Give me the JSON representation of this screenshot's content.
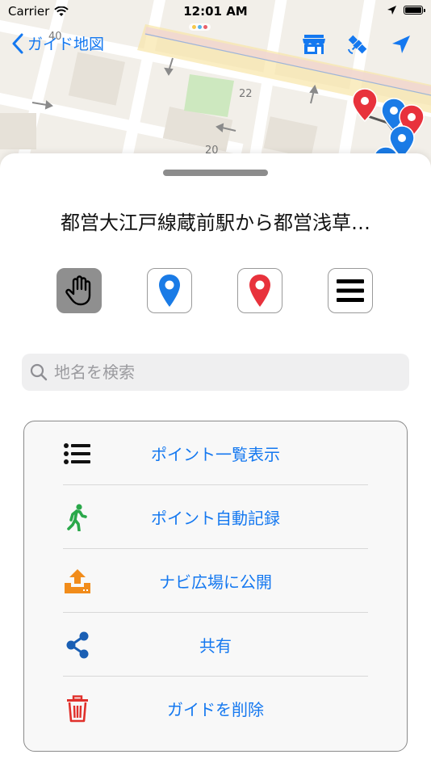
{
  "status_bar": {
    "carrier": "Carrier",
    "time": "12:01 AM"
  },
  "nav": {
    "back_label": "ガイド地図",
    "icons": [
      "store-icon",
      "satellite-icon",
      "location-arrow-icon"
    ]
  },
  "map": {
    "labels": [
      "40",
      "22",
      "20"
    ]
  },
  "sheet": {
    "title": "都営大江戸線蔵前駅から都営浅草…",
    "modes": [
      {
        "name": "hand-mode",
        "active": true
      },
      {
        "name": "blue-pin-mode",
        "active": false
      },
      {
        "name": "red-pin-mode",
        "active": false
      },
      {
        "name": "menu-mode",
        "active": false
      }
    ],
    "search_placeholder": "地名を検索",
    "menu_items": [
      {
        "label": "ポイント一覧表示",
        "icon": "list-icon"
      },
      {
        "label": "ポイント自動記録",
        "icon": "walking-icon"
      },
      {
        "label": "ナビ広場に公開",
        "icon": "upload-icon"
      },
      {
        "label": "共有",
        "icon": "share-icon"
      },
      {
        "label": "ガイドを削除",
        "icon": "trash-icon"
      }
    ]
  },
  "colors": {
    "accent": "#1478f0",
    "red_pin": "#e8323c",
    "blue_pin": "#1a7be6",
    "green": "#2aa84a",
    "orange": "#f18c1b",
    "share_blue": "#1a5fb4",
    "trash_red": "#e0302b"
  }
}
